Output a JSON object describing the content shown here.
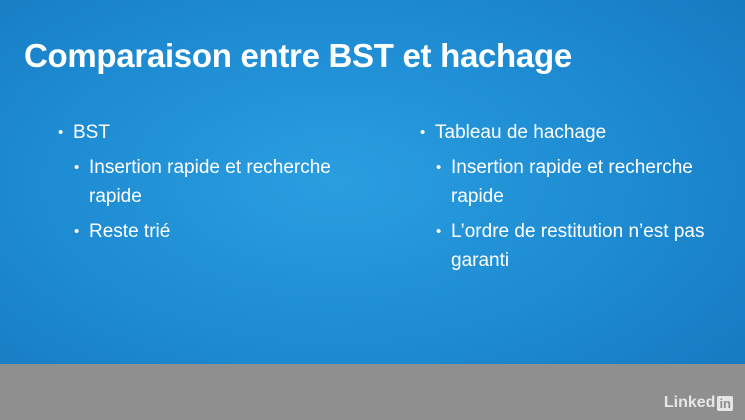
{
  "slide": {
    "title": "Comparaison entre BST et hachage",
    "left": {
      "heading": "BST",
      "items": [
        "Insertion rapide et recherche rapide",
        "Reste trié"
      ]
    },
    "right": {
      "heading": "Tableau de hachage",
      "items": [
        "Insertion rapide et recherche rapide",
        "L’ordre de restitution n’est pas garanti"
      ]
    }
  },
  "footer": {
    "logo_text": "Linked",
    "logo_box": "in"
  },
  "colors": {
    "slide_bg": "#1d8ad1",
    "footer_bg": "#8f8f8f",
    "text": "#ffffff"
  }
}
